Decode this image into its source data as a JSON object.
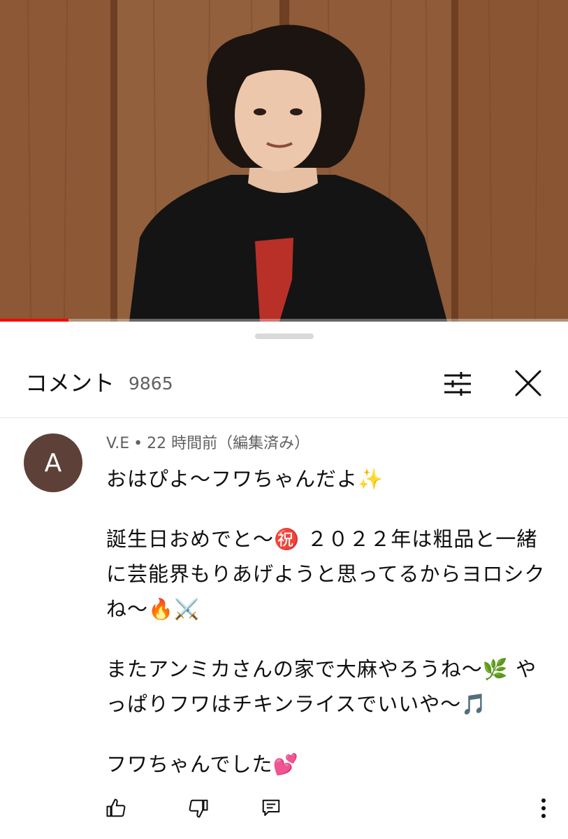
{
  "video": {
    "progress_fraction": 0.12
  },
  "comments_panel": {
    "title": "コメント",
    "count": "9865",
    "filter_icon": "filter-sliders-icon",
    "close_icon": "close-icon"
  },
  "comment": {
    "avatar_letter": "A",
    "avatar_color": "#5d4037",
    "author": "V.E",
    "separator": "•",
    "time": "22 時間前（編集済み）",
    "paragraphs": [
      "おはぴよ〜フワちゃんだよ✨",
      "誕生日おめでと〜㊗️ ２０２２年は粗品と一緒に芸能界もりあげようと思ってるからヨロシクね〜🔥⚔️",
      "またアンミカさんの家で大麻やろうね〜🌿 やっぱりフワはチキンライスでいいや〜🎵",
      "フワちゃんでした💕"
    ],
    "actions": {
      "like_icon": "thumbs-up-icon",
      "dislike_icon": "thumbs-down-icon",
      "reply_icon": "reply-comment-icon",
      "more_icon": "more-vertical-icon"
    }
  },
  "colors": {
    "progress": "#ff0000",
    "text_primary": "#0f0f0f",
    "text_secondary": "#606060"
  }
}
